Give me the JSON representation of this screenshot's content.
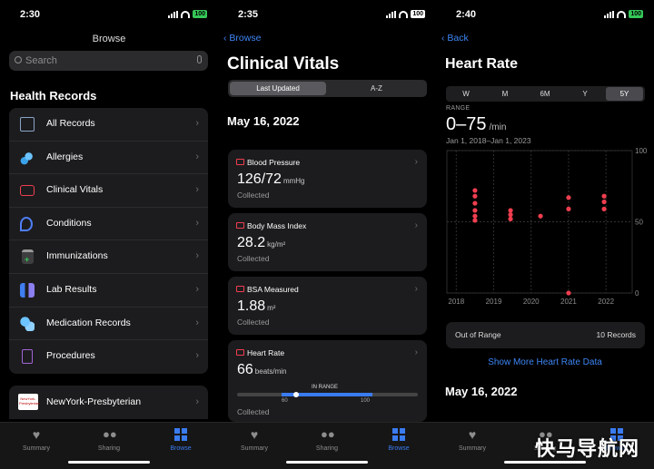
{
  "panel1": {
    "time": "2:30",
    "battery": "100",
    "title": "Browse",
    "search_placeholder": "Search",
    "section_title": "Health Records",
    "items": [
      {
        "label": "All Records"
      },
      {
        "label": "Allergies"
      },
      {
        "label": "Clinical Vitals"
      },
      {
        "label": "Conditions"
      },
      {
        "label": "Immunizations"
      },
      {
        "label": "Lab Results"
      },
      {
        "label": "Medication Records"
      },
      {
        "label": "Procedures"
      }
    ],
    "provider": "NewYork-Presbyterian",
    "provider_logo_text": "NewYork-Presbyterian"
  },
  "panel2": {
    "time": "2:35",
    "battery": "100",
    "back_label": "Browse",
    "title": "Clinical Vitals",
    "segments": [
      "Last Updated",
      "A-Z"
    ],
    "date": "May 16, 2022",
    "cards": [
      {
        "title": "Blood Pressure",
        "value": "126/72",
        "unit": "mmHg",
        "status": "Collected"
      },
      {
        "title": "Body Mass Index",
        "value": "28.2",
        "unit": "kg/m²",
        "status": "Collected"
      },
      {
        "title": "BSA Measured",
        "value": "1.88",
        "unit": "m²",
        "status": "Collected"
      },
      {
        "title": "Heart Rate",
        "value": "66",
        "unit": "beats/min",
        "status": "Collected",
        "range_label": "IN RANGE",
        "range_low": "60",
        "range_high": "100"
      }
    ]
  },
  "panel3": {
    "time": "2:40",
    "battery": "100",
    "back_label": "Back",
    "title": "Heart Rate",
    "periods": [
      "W",
      "M",
      "6M",
      "Y",
      "5Y"
    ],
    "range_label": "RANGE",
    "range_value": "0–75",
    "range_unit": "/min",
    "range_dates": "Jan 1, 2018–Jan 1, 2023",
    "out_of_range_label": "Out of Range",
    "out_of_range_count": "10 Records",
    "show_more": "Show More Heart Rate Data",
    "date": "May 16, 2022"
  },
  "tabs": [
    "Summary",
    "Sharing",
    "Browse"
  ],
  "watermark": "快马导航网",
  "colors": {
    "accent": "#3d86f5",
    "heart": "#ef3e4f",
    "battery": "#35c759"
  },
  "chart_data": {
    "type": "scatter",
    "x_labels": [
      "2018",
      "2019",
      "2020",
      "2021",
      "2022"
    ],
    "y_ticks": [
      0,
      50,
      100
    ],
    "ylim": [
      0,
      100
    ],
    "points": [
      {
        "x": 2018.5,
        "y": 72
      },
      {
        "x": 2018.5,
        "y": 68
      },
      {
        "x": 2018.5,
        "y": 63
      },
      {
        "x": 2018.5,
        "y": 58
      },
      {
        "x": 2018.5,
        "y": 54
      },
      {
        "x": 2018.5,
        "y": 51
      },
      {
        "x": 2019.45,
        "y": 58
      },
      {
        "x": 2019.45,
        "y": 55
      },
      {
        "x": 2019.45,
        "y": 52
      },
      {
        "x": 2020.25,
        "y": 54
      },
      {
        "x": 2021.0,
        "y": 67
      },
      {
        "x": 2021.0,
        "y": 59
      },
      {
        "x": 2021.0,
        "y": 0
      },
      {
        "x": 2021.95,
        "y": 68
      },
      {
        "x": 2021.95,
        "y": 64
      },
      {
        "x": 2021.95,
        "y": 59
      }
    ]
  }
}
